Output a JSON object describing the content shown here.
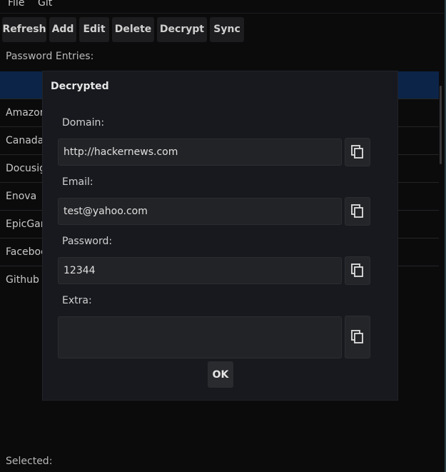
{
  "menu": {
    "items": [
      "File",
      "Git"
    ]
  },
  "toolbar": {
    "buttons": [
      "Refresh",
      "Add",
      "Edit",
      "Delete",
      "Decrypt",
      "Sync"
    ]
  },
  "entries_label": "Password Entries:",
  "list": {
    "rows": [
      "",
      "Amazon",
      "Canada",
      "Docusig",
      "Enova",
      "EpicGam",
      "Faceboo",
      "Github"
    ],
    "selected_index": 0
  },
  "selected_label": "Selected:",
  "dialog": {
    "title": "Decrypted",
    "domain": {
      "label": "Domain:",
      "value": "http://hackernews.com"
    },
    "email": {
      "label": "Email:",
      "value": "test@yahoo.com"
    },
    "password": {
      "label": "Password:",
      "value": "12344"
    },
    "extra": {
      "label": "Extra:",
      "value": ""
    },
    "ok_label": "OK",
    "copy_icon": "copy-icon"
  }
}
